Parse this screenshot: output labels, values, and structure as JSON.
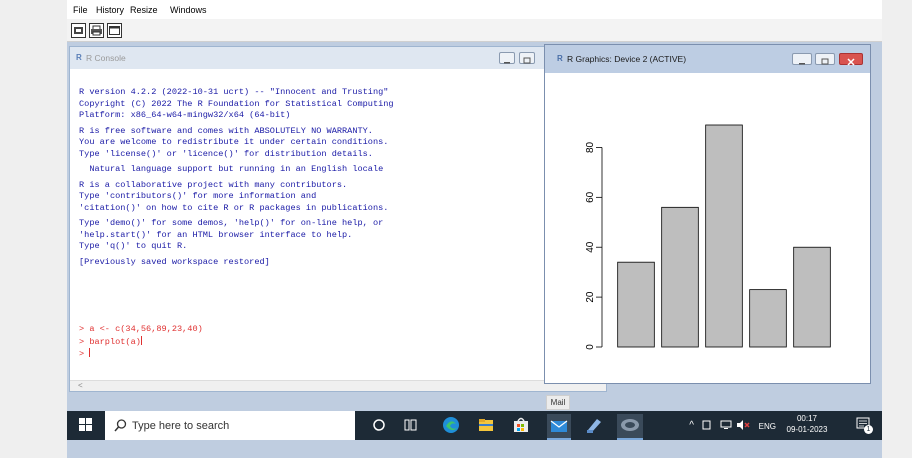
{
  "menu": [
    "File",
    "History",
    "Resize",
    "Windows"
  ],
  "console": {
    "title": "R Console",
    "lines": [
      "R version 4.2.2 (2022-10-31 ucrt) -- \"Innocent and Trusting\"",
      "Copyright (C) 2022 The R Foundation for Statistical Computing",
      "Platform: x86_64-w64-mingw32/x64 (64-bit)",
      "",
      "R is free software and comes with ABSOLUTELY NO WARRANTY.",
      "You are welcome to redistribute it under certain conditions.",
      "Type 'license()' or 'licence()' for distribution details.",
      "",
      "  Natural language support but running in an English locale",
      "",
      "R is a collaborative project with many contributors.",
      "Type 'contributors()' for more information and",
      "'citation()' on how to cite R or R packages in publications.",
      "",
      "Type 'demo()' for some demos, 'help()' for on-line help, or",
      "'help.start()' for an HTML browser interface to help.",
      "Type 'q()' to quit R.",
      "",
      "[Previously saved workspace restored]"
    ],
    "commands": [
      "> a <- c(34,56,89,23,40)",
      "> barplot(a)",
      "> "
    ],
    "scroll_left": "<"
  },
  "graphics": {
    "title": "R Graphics: Device 2 (ACTIVE)"
  },
  "chart_data": {
    "type": "bar",
    "categories": [
      "",
      "",
      "",
      "",
      ""
    ],
    "values": [
      34,
      56,
      89,
      23,
      40
    ],
    "title": "",
    "xlabel": "",
    "ylabel": "",
    "ylim": [
      0,
      89
    ],
    "yticks": [
      0,
      20,
      40,
      60,
      80
    ],
    "bar_color": "#bebebe",
    "grid": false
  },
  "tooltip": "Mail",
  "taskbar": {
    "search_placeholder": "Type here to search",
    "language": "ENG",
    "time": "00:17",
    "date": "09-01-2023",
    "notification_count": "1"
  }
}
